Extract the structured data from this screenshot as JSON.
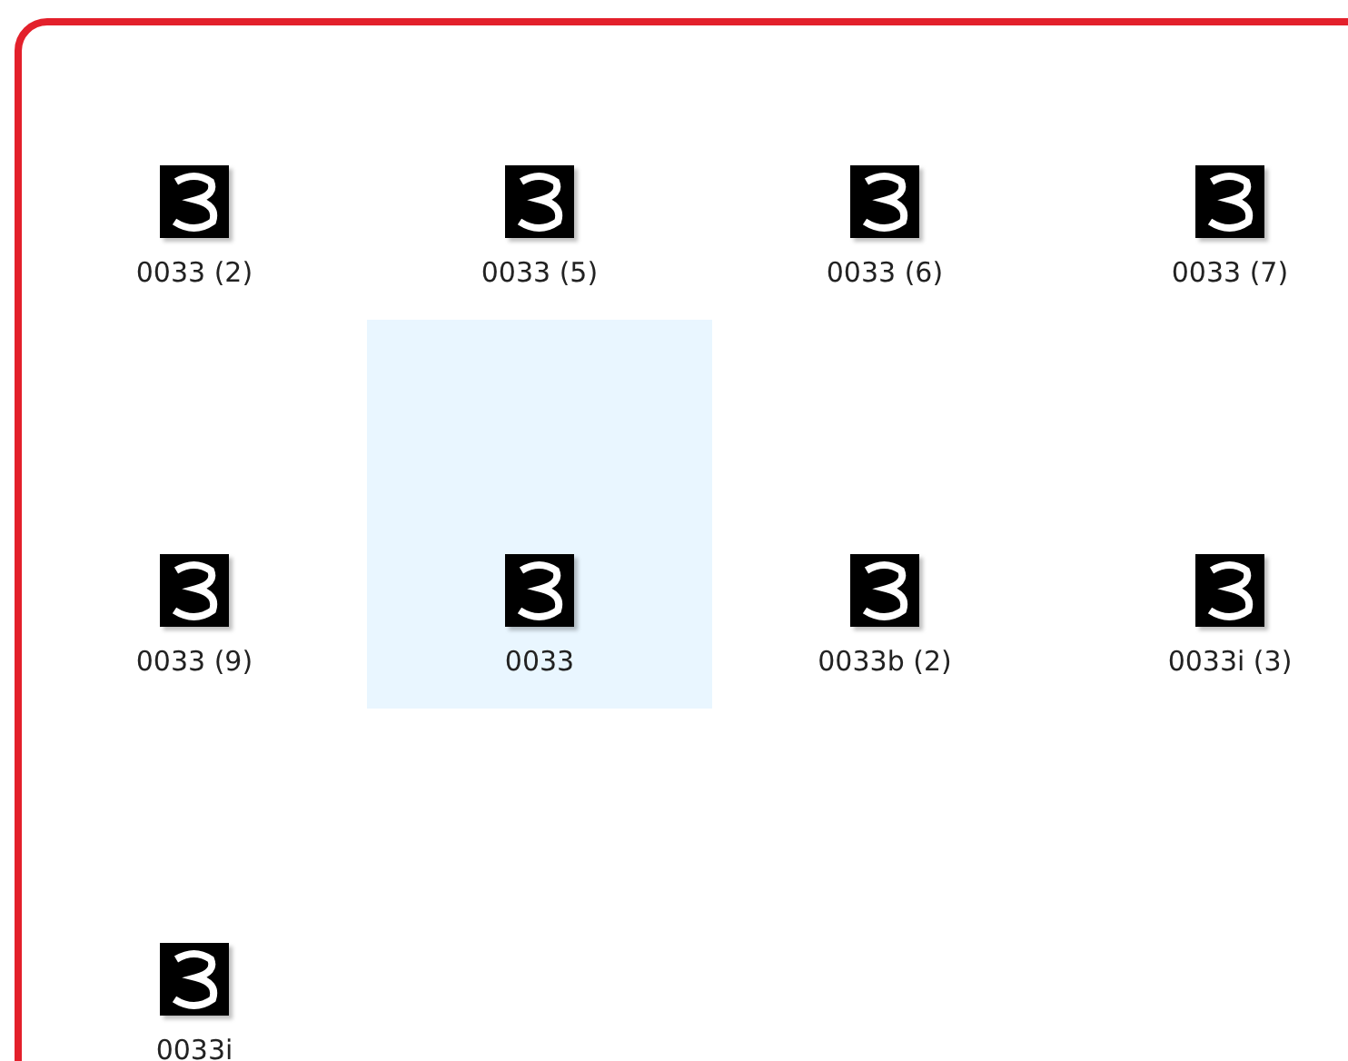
{
  "files": [
    {
      "name": "0033 (2)",
      "selected": false
    },
    {
      "name": "0033 (5)",
      "selected": false
    },
    {
      "name": "0033 (6)",
      "selected": false
    },
    {
      "name": "0033 (7)",
      "selected": false
    },
    {
      "name": "0033 (9)",
      "selected": false
    },
    {
      "name": "0033",
      "selected": true
    },
    {
      "name": "0033b (2)",
      "selected": false
    },
    {
      "name": "0033i (3)",
      "selected": false
    },
    {
      "name": "0033i",
      "selected": false
    }
  ]
}
